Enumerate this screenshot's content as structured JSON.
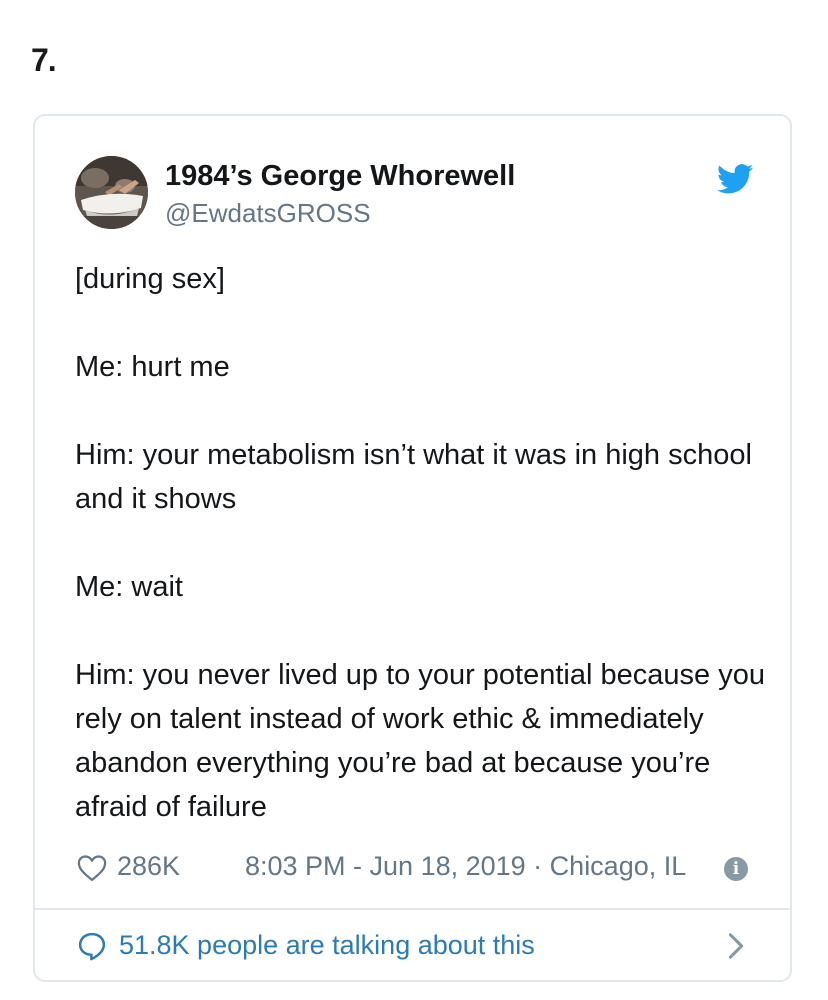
{
  "list_number": "7.",
  "tweet": {
    "author_name": "1984’s George Whorewell",
    "author_handle": "@EwdatsGROSS",
    "paragraphs": [
      "[during sex]",
      "Me: hurt me",
      "Him: your metabolism isn’t what it was in high school and it shows",
      "Me: wait",
      "Him: you never lived up to your potential because you rely on talent instead of work ethic & immediately abandon everything you’re bad at because you’re afraid of failure"
    ],
    "likes": "286K",
    "datetime_location": "8:03 PM - Jun 18, 2019 · Chicago, IL",
    "talking_text": "51.8K people are talking about this"
  },
  "colors": {
    "twitter_blue": "#1da1f2",
    "link_blue": "#2b7bb9",
    "secondary_gray": "#657786",
    "border_gray": "#e1e8ed"
  },
  "icons": [
    "twitter-bird-icon",
    "heart-icon",
    "info-icon",
    "speech-bubble-icon",
    "chevron-right-icon"
  ]
}
